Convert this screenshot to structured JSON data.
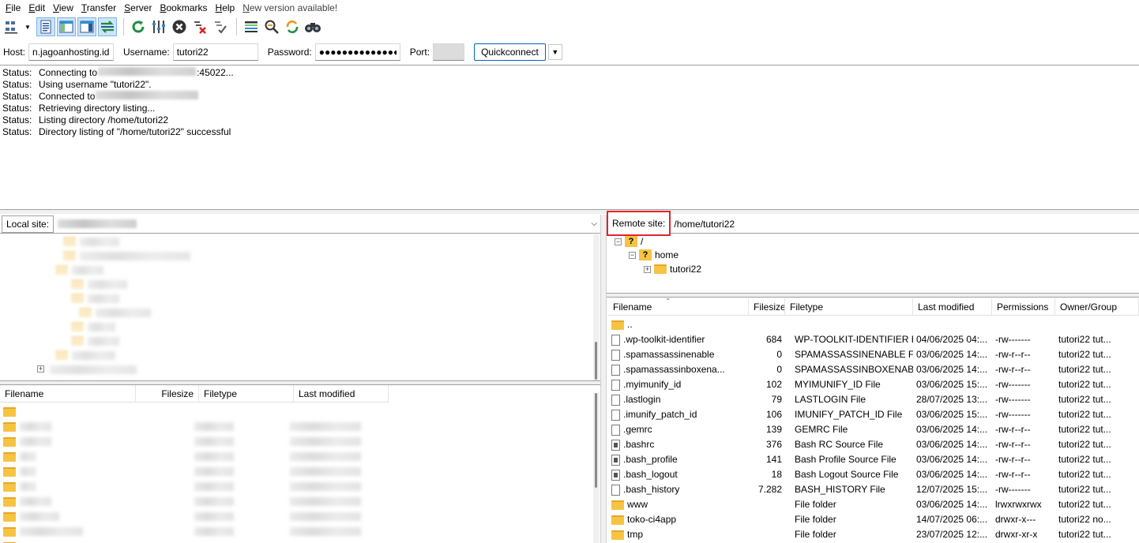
{
  "menu": [
    "File",
    "Edit",
    "View",
    "Transfer",
    "Server",
    "Bookmarks",
    "Help",
    "New version available!"
  ],
  "toolbar": {
    "buttons": [
      "site-manager",
      "toggle-message-log",
      "toggle-local-tree",
      "toggle-remote-tree",
      "toggle-transfer-queue",
      "refresh",
      "process-queue",
      "cancel",
      "disconnect",
      "reconnect",
      "directory-listing-filters",
      "toggle-comparison",
      "sync-browsing",
      "search-remote-files"
    ]
  },
  "quickconnect": {
    "host_label": "Host:",
    "host_value": "n.jagoanhosting.id",
    "username_label": "Username:",
    "username_value": "tutori22",
    "password_label": "Password:",
    "password_value": "●●●●●●●●●●●●●●",
    "port_label": "Port:",
    "port_value": "",
    "button": "Quickconnect",
    "dropdown": "▼"
  },
  "log": [
    {
      "kind": "Status:",
      "before": "Connecting to ",
      "after": ":45022..."
    },
    {
      "kind": "Status:",
      "before": "Using username \"tutori22\".",
      "after": ""
    },
    {
      "kind": "Status:",
      "before": "Connected to ",
      "after": ""
    },
    {
      "kind": "Status:",
      "before": "Retrieving directory listing...",
      "after": ""
    },
    {
      "kind": "Status:",
      "before": "Listing directory /home/tutori22",
      "after": ""
    },
    {
      "kind": "Status:",
      "before": "Directory listing of \"/home/tutori22\" successful",
      "after": ""
    }
  ],
  "local": {
    "site_label": "Local site:",
    "columns": [
      "Filename",
      "Filesize",
      "Filetype",
      "Last modified"
    ]
  },
  "remote": {
    "site_label": "Remote site:",
    "site_path": "/home/tutori22",
    "tree": [
      {
        "label": "/",
        "icon": "question-folder-icon"
      },
      {
        "label": "home",
        "icon": "question-folder-icon"
      },
      {
        "label": "tutori22",
        "icon": "folder-icon"
      }
    ],
    "columns": [
      "Filename",
      "Filesize",
      "Filetype",
      "Last modified",
      "Permissions",
      "Owner/Group"
    ],
    "files": [
      {
        "name": "..",
        "size": "",
        "type": "",
        "modified": "",
        "perms": "",
        "owner": "",
        "icon": "folder"
      },
      {
        "name": ".wp-toolkit-identifier",
        "size": "684",
        "type": "WP-TOOLKIT-IDENTIFIER F...",
        "modified": "04/06/2025 04:...",
        "perms": "-rw-------",
        "owner": "tutori22 tut...",
        "icon": "file"
      },
      {
        "name": ".spamassassinenable",
        "size": "0",
        "type": "SPAMASSASSINENABLE File",
        "modified": "03/06/2025 14:...",
        "perms": "-rw-r--r--",
        "owner": "tutori22 tut...",
        "icon": "file"
      },
      {
        "name": ".spamassassinboxena...",
        "size": "0",
        "type": "SPAMASSASSINBOXENAB...",
        "modified": "03/06/2025 14:...",
        "perms": "-rw-r--r--",
        "owner": "tutori22 tut...",
        "icon": "file"
      },
      {
        "name": ".myimunify_id",
        "size": "102",
        "type": "MYIMUNIFY_ID File",
        "modified": "03/06/2025 15:...",
        "perms": "-rw-------",
        "owner": "tutori22 tut...",
        "icon": "file"
      },
      {
        "name": ".lastlogin",
        "size": "79",
        "type": "LASTLOGIN File",
        "modified": "28/07/2025 13:...",
        "perms": "-rw-------",
        "owner": "tutori22 tut...",
        "icon": "file"
      },
      {
        "name": ".imunify_patch_id",
        "size": "106",
        "type": "IMUNIFY_PATCH_ID File",
        "modified": "03/06/2025 15:...",
        "perms": "-rw-------",
        "owner": "tutori22 tut...",
        "icon": "file"
      },
      {
        "name": ".gemrc",
        "size": "139",
        "type": "GEMRC File",
        "modified": "03/06/2025 14:...",
        "perms": "-rw-r--r--",
        "owner": "tutori22 tut...",
        "icon": "file"
      },
      {
        "name": ".bashrc",
        "size": "376",
        "type": "Bash RC Source File",
        "modified": "03/06/2025 14:...",
        "perms": "-rw-r--r--",
        "owner": "tutori22 tut...",
        "icon": "script"
      },
      {
        "name": ".bash_profile",
        "size": "141",
        "type": "Bash Profile Source File",
        "modified": "03/06/2025 14:...",
        "perms": "-rw-r--r--",
        "owner": "tutori22 tut...",
        "icon": "script"
      },
      {
        "name": ".bash_logout",
        "size": "18",
        "type": "Bash Logout Source File",
        "modified": "03/06/2025 14:...",
        "perms": "-rw-r--r--",
        "owner": "tutori22 tut...",
        "icon": "script"
      },
      {
        "name": ".bash_history",
        "size": "7.282",
        "type": "BASH_HISTORY File",
        "modified": "12/07/2025 15:...",
        "perms": "-rw-------",
        "owner": "tutori22 tut...",
        "icon": "file"
      },
      {
        "name": "www",
        "size": "",
        "type": "File folder",
        "modified": "03/06/2025 14:...",
        "perms": "lrwxrwxrwx",
        "owner": "tutori22 tut...",
        "icon": "folder"
      },
      {
        "name": "toko-ci4app",
        "size": "",
        "type": "File folder",
        "modified": "14/07/2025 06:...",
        "perms": "drwxr-x---",
        "owner": "tutori22 no...",
        "icon": "folder"
      },
      {
        "name": "tmp",
        "size": "",
        "type": "File folder",
        "modified": "23/07/2025 12:...",
        "perms": "drwxr-xr-x",
        "owner": "tutori22 tut...",
        "icon": "folder"
      }
    ]
  },
  "colors": {
    "highlight_box": "#e0242c",
    "folder": "#f6c343",
    "active_button": "#cce4f7"
  }
}
